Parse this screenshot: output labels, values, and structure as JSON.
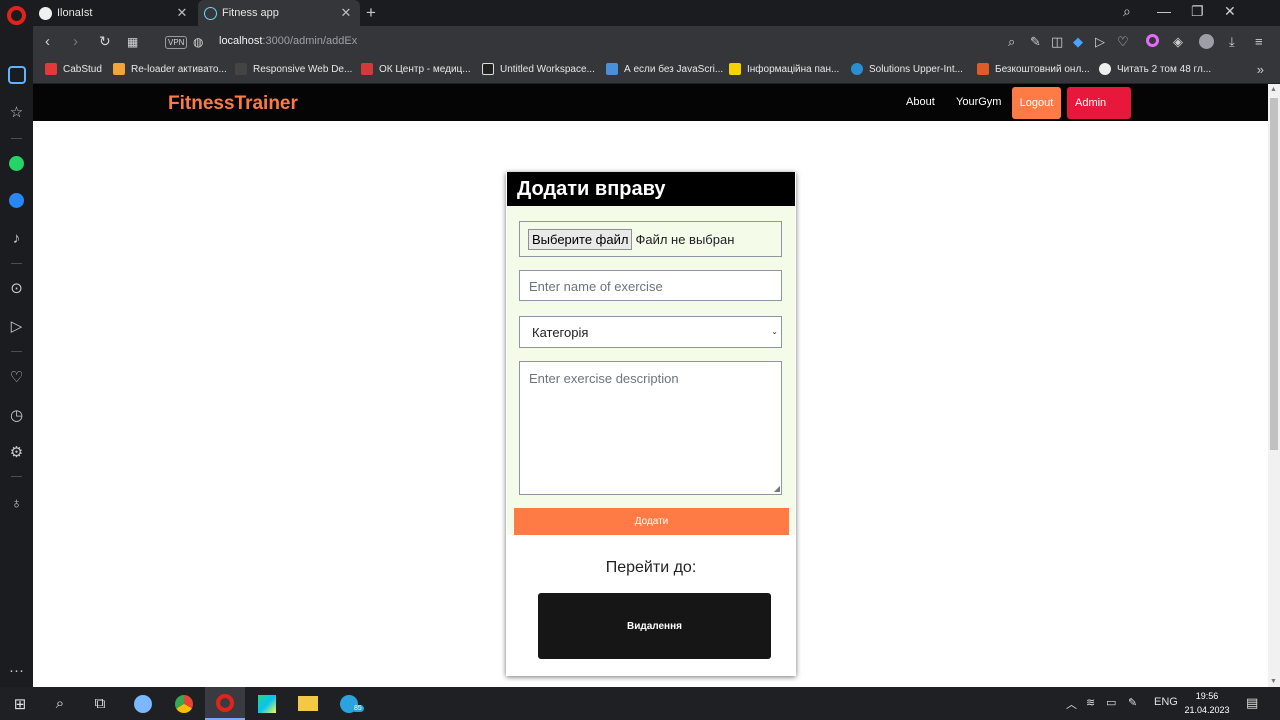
{
  "browser": {
    "tabs": [
      {
        "title": "IlonaIst",
        "favicon": "github-icon"
      },
      {
        "title": "Fitness app",
        "favicon": "react-icon",
        "active": true
      }
    ],
    "url_host": "localhost",
    "url_path": ":3000/admin/addEx",
    "vpn_label": "VPN",
    "bookmarks": [
      {
        "label": "CabStud",
        "color": "#e03a3a"
      },
      {
        "label": "Re-loader активато...",
        "color": "#f2a33a"
      },
      {
        "label": "Responsive Web De...",
        "color": "#444444"
      },
      {
        "label": "ОК Центр - медиц...",
        "color": "#d33a3a"
      },
      {
        "label": "Untitled Workspace...",
        "color": "#222222"
      },
      {
        "label": "А если без JavaScri...",
        "color": "#4a90d9"
      },
      {
        "label": "Інформаційна пан...",
        "color": "#f5d300"
      },
      {
        "label": "Solutions Upper-Int...",
        "color": "#2a8fd0"
      },
      {
        "label": "Безкоштовний онл...",
        "color": "#e05a2a"
      },
      {
        "label": "Читать 2 том 48 гл...",
        "color": "#eeeeee"
      }
    ]
  },
  "app": {
    "brand": "FitnessTrainer",
    "nav": {
      "about": "About",
      "gym": "YourGym",
      "logout": "Logout",
      "admin": "Admin"
    },
    "colors": {
      "accent": "#ff7b45",
      "admin": "#e8183c",
      "form_bg": "#f4fbe9"
    }
  },
  "form": {
    "title": "Додати вправу",
    "file_button": "Выберите файл",
    "file_status": "Файл не выбран",
    "name_placeholder": "Enter name of exercise",
    "category_selected": "Категорія",
    "description_placeholder": "Enter exercise description",
    "submit_label": "Додати",
    "goto_label": "Перейти до:",
    "delete_label": "Видалення"
  },
  "taskbar": {
    "lang": "ENG",
    "time": "19:56",
    "date": "21.04.2023",
    "telegram_badge": "85"
  }
}
